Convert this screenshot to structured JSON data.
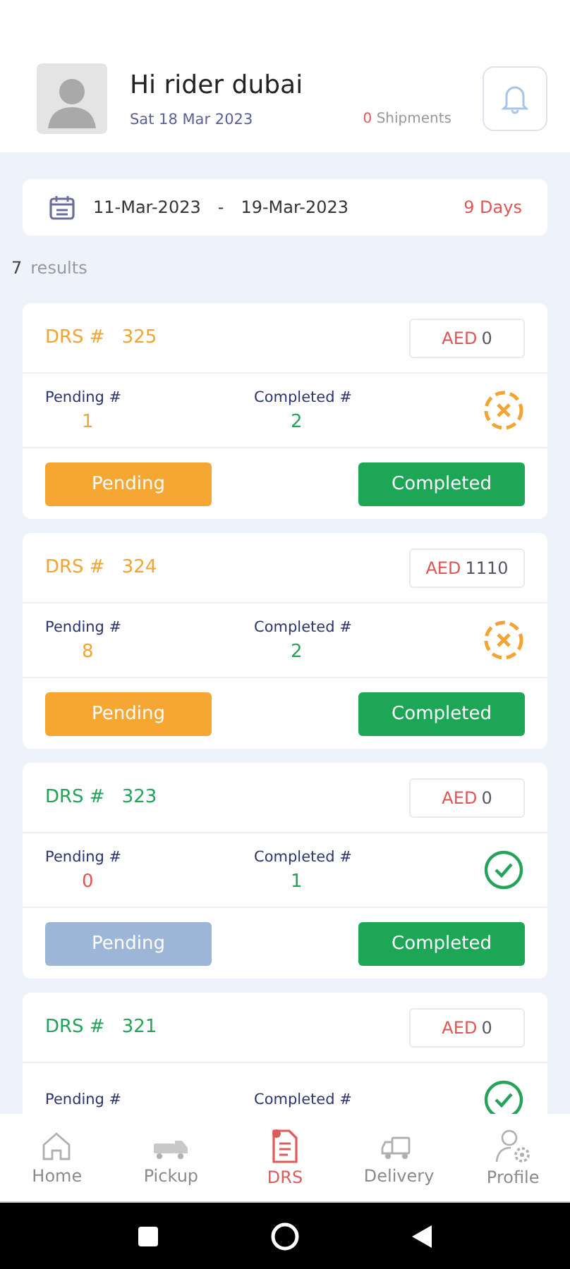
{
  "header": {
    "greeting": "Hi rider dubai",
    "date": "Sat 18 Mar 2023",
    "shipments_count": "0",
    "shipments_label": "Shipments"
  },
  "date_range": {
    "from": "11-Mar-2023",
    "separator": "-",
    "to": "19-Mar-2023",
    "days": "9 Days"
  },
  "results": {
    "count": "7",
    "label": "results"
  },
  "cards": [
    {
      "completed": false,
      "drs_label": "DRS #",
      "drs_number": "325",
      "currency": "AED",
      "amount": "0",
      "pending_label": "Pending #",
      "pending_value": "1",
      "completed_label": "Completed #",
      "completed_value": "2",
      "pending_button": {
        "label": "Pending",
        "disabled": false
      },
      "completed_button": {
        "label": "Completed",
        "disabled": false
      }
    },
    {
      "completed": false,
      "drs_label": "DRS #",
      "drs_number": "324",
      "currency": "AED",
      "amount": "1110",
      "pending_label": "Pending #",
      "pending_value": "8",
      "completed_label": "Completed #",
      "completed_value": "2",
      "pending_button": {
        "label": "Pending",
        "disabled": false
      },
      "completed_button": {
        "label": "Completed",
        "disabled": false
      }
    },
    {
      "completed": true,
      "drs_label": "DRS #",
      "drs_number": "323",
      "currency": "AED",
      "amount": "0",
      "pending_label": "Pending #",
      "pending_value": "0",
      "completed_label": "Completed #",
      "completed_value": "1",
      "pending_button": {
        "label": "Pending",
        "disabled": true
      },
      "completed_button": {
        "label": "Completed",
        "disabled": false
      }
    },
    {
      "completed": true,
      "drs_label": "DRS #",
      "drs_number": "321",
      "currency": "AED",
      "amount": "0",
      "pending_label": "Pending #",
      "completed_label": "Completed #"
    }
  ],
  "nav": [
    {
      "kind": "home",
      "label": "Home",
      "selected": false
    },
    {
      "kind": "pickup",
      "label": "Pickup",
      "selected": false
    },
    {
      "kind": "drs",
      "label": "DRS",
      "selected": true
    },
    {
      "kind": "delivery",
      "label": "Delivery",
      "selected": false
    },
    {
      "kind": "profile",
      "label": "Profile",
      "selected": false
    }
  ]
}
